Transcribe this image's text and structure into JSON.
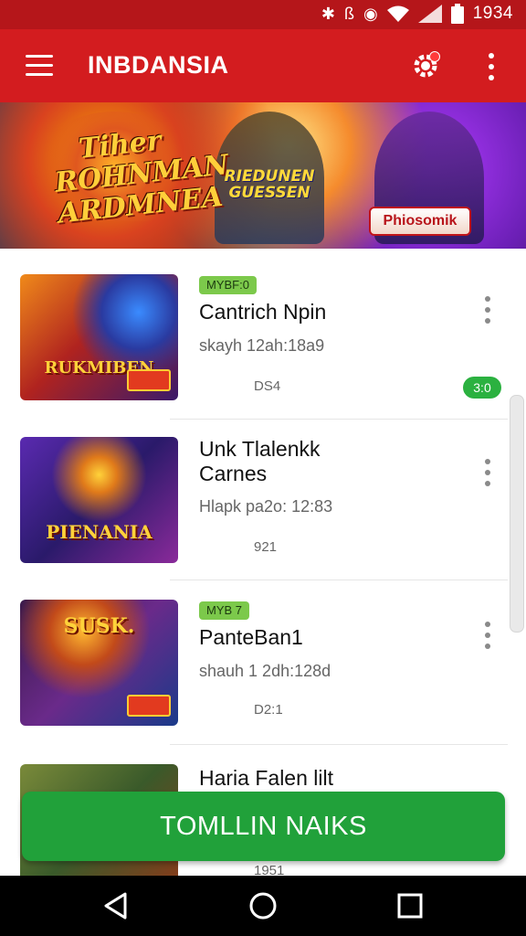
{
  "status_bar": {
    "time": "1934",
    "icons": [
      "bluetooth-icon",
      "nfc-icon",
      "alarm-icon",
      "wifi-icon",
      "signal-icon",
      "battery-icon"
    ]
  },
  "app_bar": {
    "title": "INBDANSIA",
    "icons": [
      "menu-icon",
      "settings-icon",
      "more-vert-icon"
    ]
  },
  "banner": {
    "title": "Tiher ROHNMAN ARDMNEA",
    "subtitle": "RIEDUNEN GUESSEN",
    "badge": "Phiosomik"
  },
  "list": {
    "items": [
      {
        "tag": "MYBF:0",
        "name": "Cantrich Npin",
        "meta": "skayh 12ah:18a9",
        "count": "DS4",
        "score": "3:0",
        "thumb_label": "RUKMIBEN"
      },
      {
        "tag": "",
        "name": "Unk Tlalenkk Carnes",
        "meta": "Hlapk pa2o: 12:83",
        "count": "921",
        "score": "",
        "thumb_label": "PIENANIA"
      },
      {
        "tag": "MYB 7",
        "name": "PanteBan1",
        "meta": "shauh 1 2dh:128d",
        "count": "D2:1",
        "score": "",
        "thumb_label": "SUSK."
      },
      {
        "tag": "",
        "name": "Haria Falen lilt",
        "meta": "",
        "count": "1951",
        "score": "",
        "thumb_label": ""
      }
    ]
  },
  "cta": {
    "label": "TOMLLIN NAIKS"
  },
  "colors": {
    "primary": "#d31c1f",
    "status_bar": "#b5161a",
    "tag_green": "#7cc94b",
    "cta_green": "#21a13a"
  }
}
